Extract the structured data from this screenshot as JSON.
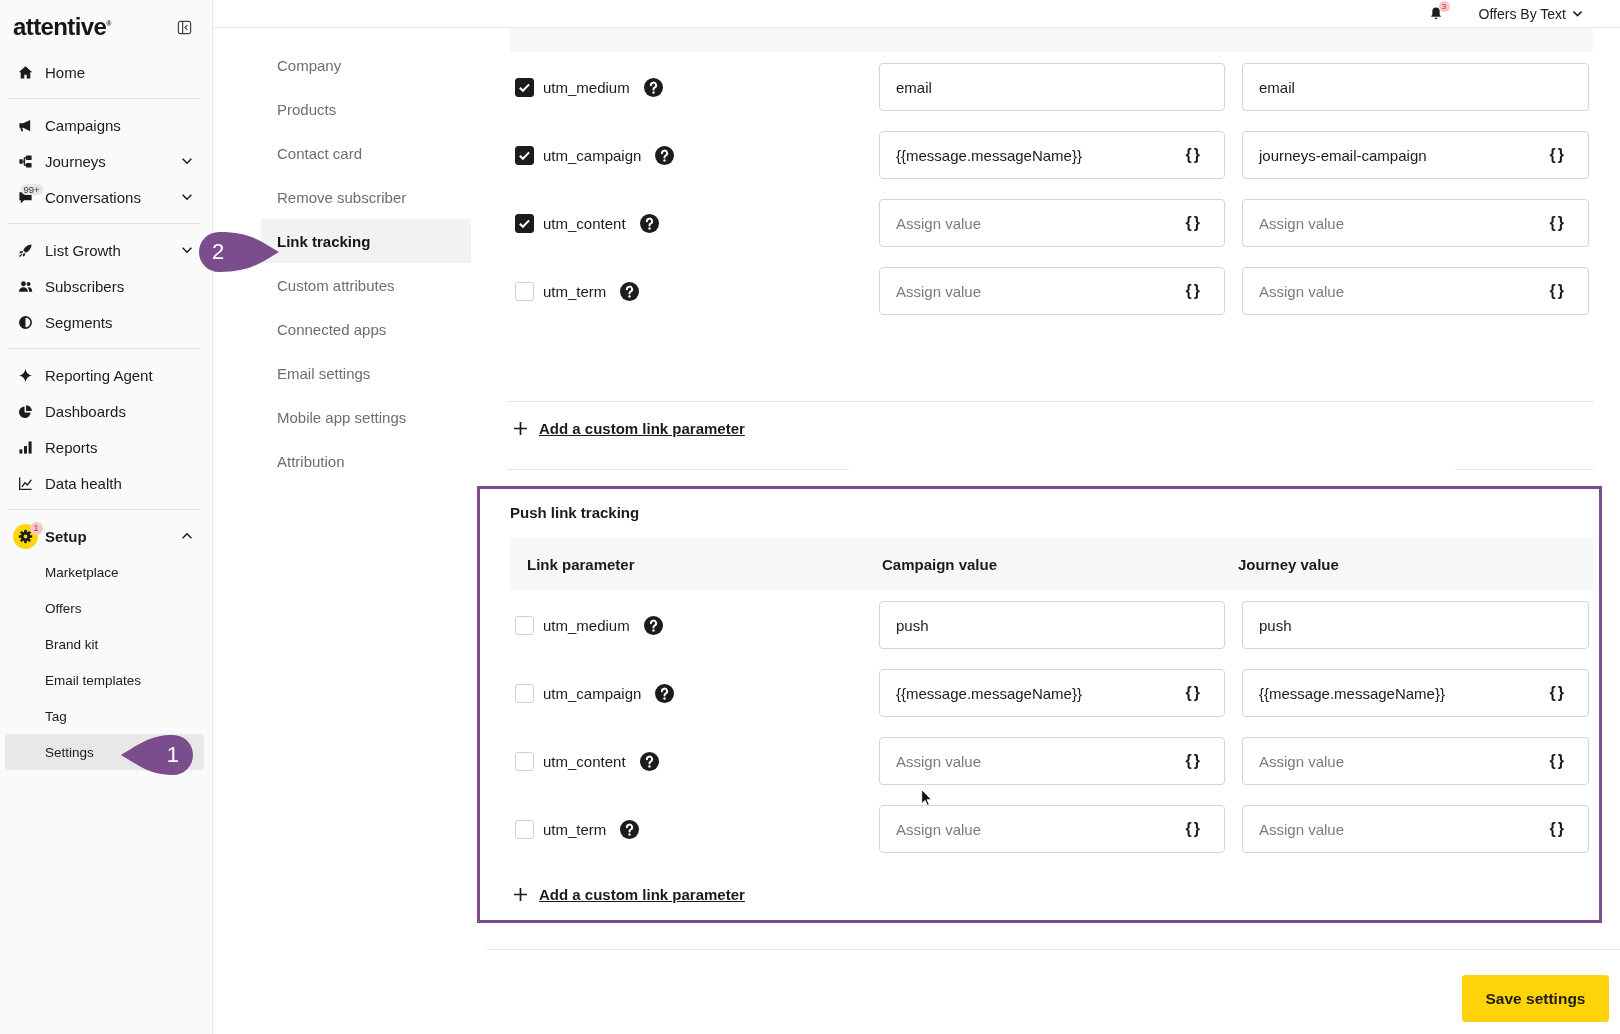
{
  "sidebar": {
    "logo": "attentive$^{®}$",
    "groups": [
      {
        "items": [
          {
            "label": "Home",
            "selected": false
          }
        ]
      },
      {
        "items": [
          {
            "label": "Campaigns",
            "selected": false
          },
          {
            "label": "Journeys",
            "selected": false,
            "expanded": false
          },
          {
            "label": "Conversations",
            "selected": false,
            "expanded": false,
            "badge": {
              "text": "99+",
              "kind": "count"
            }
          }
        ]
      },
      {
        "items": [
          {
            "label": "List Growth",
            "selected": false,
            "expanded": false
          },
          {
            "label": "Subscribers",
            "selected": false
          },
          {
            "label": "Segments",
            "selected": false
          }
        ]
      },
      {
        "items": [
          {
            "label": "Reporting Agent",
            "selected": false
          },
          {
            "label": "Dashboards",
            "selected": false
          },
          {
            "label": "Reports",
            "selected": false
          },
          {
            "label": "Data health",
            "selected": false
          }
        ]
      },
      {
        "items": [
          {
            "label": "Setup",
            "selected": false,
            "expanded": true,
            "badge": {
              "text": "1",
              "kind": "alert"
            },
            "children": [
              {
                "label": "Marketplace",
                "selected": false
              },
              {
                "label": "Offers",
                "selected": false
              },
              {
                "label": "Brand kit",
                "selected": false
              },
              {
                "label": "Email templates",
                "selected": false
              },
              {
                "label": "Tag",
                "selected": false
              },
              {
                "label": "Settings",
                "selected": true,
                "callout": "1"
              }
            ]
          }
        ]
      }
    ]
  },
  "top_bar": {
    "notifications": {
      "text": "3",
      "kind": "alert"
    },
    "account": "Offers By Text"
  },
  "settings_nav": [
    {
      "label": "Company",
      "selected": false
    },
    {
      "label": "Products",
      "selected": false
    },
    {
      "label": "Contact card",
      "selected": false
    },
    {
      "label": "Remove subscriber",
      "selected": false
    },
    {
      "label": "Link tracking",
      "selected": true,
      "callout": "2"
    },
    {
      "label": "Custom attributes",
      "selected": false
    },
    {
      "label": "Connected apps",
      "selected": false
    },
    {
      "label": "Email settings",
      "selected": false
    },
    {
      "label": "Mobile app settings",
      "selected": false
    },
    {
      "label": "Attribution",
      "selected": false
    }
  ],
  "parameter_table": {
    "rows": [
      {
        "parameter": "utm_medium",
        "checked": true,
        "campaign": {
          "value": "email"
        },
        "journey": {
          "value": "email"
        }
      },
      {
        "parameter": "utm_campaign",
        "checked": true,
        "campaign": {
          "value": "{{message.messageName}}",
          "insert": "{}"
        },
        "journey": {
          "value": "journeys-email-campaign",
          "insert": "{}"
        }
      },
      {
        "parameter": "utm_content",
        "checked": true,
        "campaign": {
          "placeholder": "Assign value",
          "insert": "{}"
        },
        "journey": {
          "placeholder": "Assign value",
          "insert": "{}"
        }
      },
      {
        "parameter": "utm_term",
        "checked": false,
        "campaign": {
          "placeholder": "Assign value",
          "insert": "{}"
        },
        "journey": {
          "placeholder": "Assign value",
          "insert": "{}"
        }
      }
    ],
    "add_link": "Add a custom link parameter"
  },
  "push_link_tracking": {
    "title": "Push link tracking",
    "highlighted": true,
    "columns": [
      "Link parameter",
      "Campaign value",
      "Journey value"
    ],
    "rows": [
      {
        "parameter": "utm_medium",
        "checked": false,
        "campaign": {
          "value": "push"
        },
        "journey": {
          "value": "push"
        }
      },
      {
        "parameter": "utm_campaign",
        "checked": false,
        "campaign": {
          "value": "{{message.messageName}}",
          "insert": "{}"
        },
        "journey": {
          "value": "{{message.messageName}}",
          "insert": "{}"
        }
      },
      {
        "parameter": "utm_content",
        "checked": false,
        "campaign": {
          "placeholder": "Assign value",
          "insert": "{}"
        },
        "journey": {
          "placeholder": "Assign value",
          "insert": "{}"
        }
      },
      {
        "parameter": "utm_term",
        "checked": false,
        "campaign": {
          "placeholder": "Assign value",
          "insert": "{}"
        },
        "journey": {
          "placeholder": "Assign value",
          "insert": "{}"
        }
      }
    ],
    "add_link": "Add a custom link parameter"
  },
  "save_button": "Save settings"
}
